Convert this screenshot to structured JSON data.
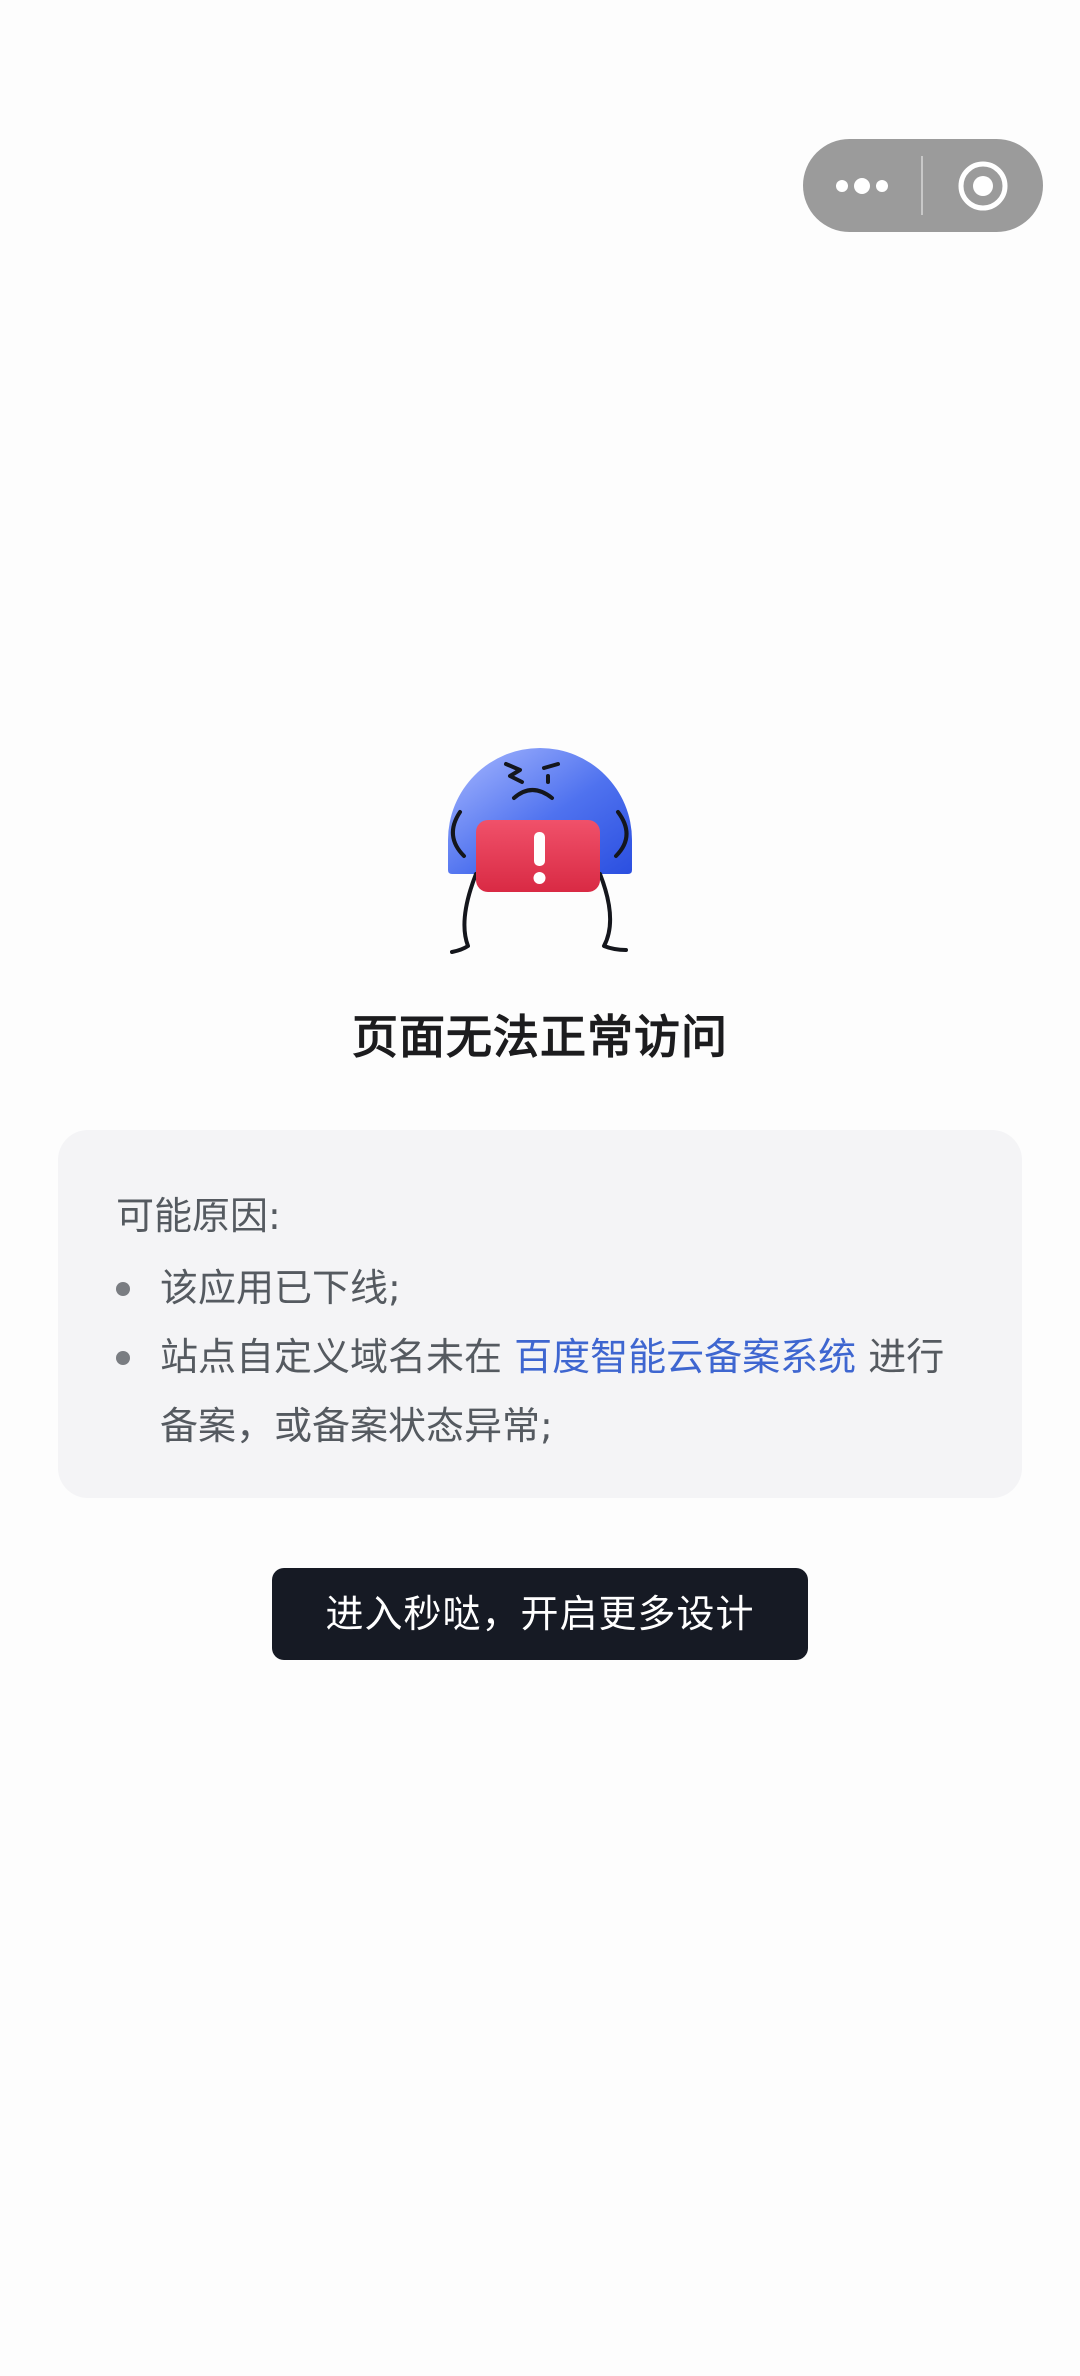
{
  "capsule": {
    "more_icon": "more-dots-icon",
    "close_icon": "target-circle-icon"
  },
  "illustration": {
    "icon": "warning-mascot-icon",
    "colors": {
      "dome": "#3f63e6",
      "warning_card": "#e8344e"
    }
  },
  "error": {
    "title": "页面无法正常访问"
  },
  "reasons": {
    "heading": "可能原因:",
    "items": [
      {
        "text": "该应用已下线;"
      },
      {
        "text_before": "站点自定义域名未在 ",
        "link": "百度智能云备案系统",
        "text_after": " 进行备案，或备案状态异常;"
      }
    ]
  },
  "cta": {
    "label": "进入秒哒，开启更多设计"
  },
  "colors": {
    "link": "#3e66d0",
    "button_bg": "#161a24",
    "card_bg": "#f4f4f6"
  }
}
